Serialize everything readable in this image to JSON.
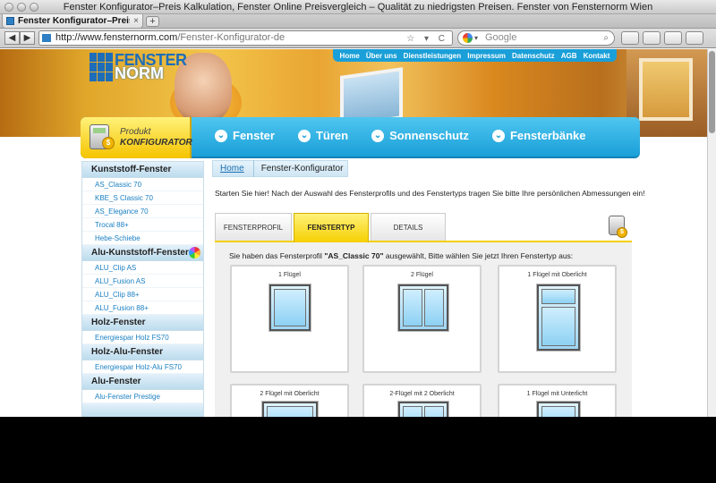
{
  "browser": {
    "window_title": "Fenster Konfigurator–Preis Kalkulation, Fenster Online Preisvergleich – Qualität zu niedrigsten Preisen. Fenster von Fensternorm Wien",
    "tab_title": "Fenster Konfigurator–Preis Kalk...",
    "new_tab_symbol": "+",
    "url_host": "http://www.fensternorm.com",
    "url_path": "/Fenster-Konfigurator-de",
    "url_icons": "☆ ▾ C",
    "search_placeholder": "Google",
    "back_symbol": "◀",
    "forward_symbol": "▶"
  },
  "site": {
    "logo_line1": "FENSTER",
    "logo_line2": "NORM",
    "top_menu": [
      "Home",
      "Über uns",
      "Dienstleistungen",
      "Impressum",
      "Datenschutz",
      "AGB",
      "Kontakt"
    ],
    "konfig_badge_line1": "Produkt",
    "konfig_badge_line2": "KONFIGURATOR",
    "coin_symbol": "$",
    "main_menu": [
      "Fenster",
      "Türen",
      "Sonnenschutz",
      "Fensterbänke"
    ]
  },
  "sidebar": {
    "sections": [
      {
        "title": "Kunststoff-Fenster",
        "links": [
          "AS_Classic 70",
          "KBE_S Classic 70",
          "AS_Elegance 70",
          "Trocal 88+",
          "Hebe-Schiebe"
        ]
      },
      {
        "title": "Alu-Kunststoff-Fenster",
        "links": [
          "ALU_Clip AS",
          "ALU_Fusion AS",
          "ALU_Clip 88+",
          "ALU_Fusion 88+"
        ]
      },
      {
        "title": "Holz-Fenster",
        "links": [
          "Energiespar Holz FS70"
        ]
      },
      {
        "title": "Holz-Alu-Fenster",
        "links": [
          "Energiespar Holz-Alu FS70"
        ]
      },
      {
        "title": "Alu-Fenster",
        "links": [
          "Alu-Fenster Prestige"
        ]
      }
    ]
  },
  "main": {
    "breadcrumb_home": "Home",
    "breadcrumb_current": "Fenster-Konfigurator",
    "intro": "Starten Sie hier! Nach der Auswahl des Fensterprofils und des Fenstertyps tragen Sie bitte Ihre persönlichen Abmessungen ein!",
    "tabs": [
      "FENSTERPROFIL",
      "FENSTERTYP",
      "DETAILS"
    ],
    "active_tab": "FENSTERTYP",
    "prompt_before": "Sie haben das Fensterprofil ",
    "prompt_profile": "\"AS_Classic 70\"",
    "prompt_after": " ausgewählt, Bitte wählen Sie jetzt Ihren Fenstertyp aus:",
    "window_types": [
      "1 Flügel",
      "2 Flügel",
      "1 Flügel mit Oberlicht",
      "2 Flügel mit Oberlicht",
      "2-Flügel mit 2 Oberlicht",
      "1 Flügel mit Unterlicht"
    ]
  }
}
